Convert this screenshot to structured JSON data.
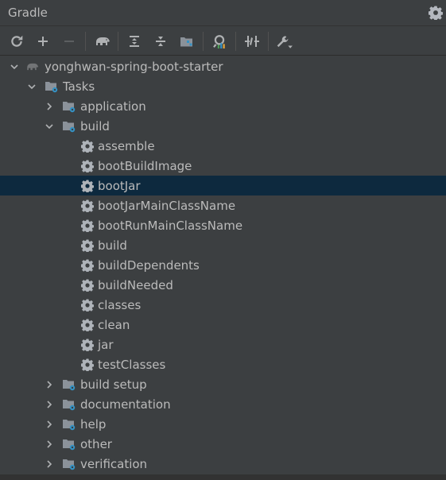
{
  "header": {
    "title": "Gradle"
  },
  "toolbar": {
    "buttons": [
      {
        "name": "reload-all-projects",
        "icon": "refresh-icon"
      },
      {
        "name": "link-project",
        "icon": "plus-icon"
      },
      {
        "name": "unlink-project",
        "icon": "minus-icon"
      },
      {
        "name": "execute-task",
        "icon": "elephant-icon"
      },
      {
        "name": "expand-all",
        "icon": "expand-all-icon"
      },
      {
        "name": "collapse-all",
        "icon": "collapse-all-icon"
      },
      {
        "name": "dependencies",
        "icon": "dependencies-icon"
      },
      {
        "name": "analyze",
        "icon": "analyze-icon"
      },
      {
        "name": "toggle-offline",
        "icon": "offline-icon"
      },
      {
        "name": "build-settings",
        "icon": "wrench-icon"
      }
    ]
  },
  "tree": {
    "project": "yonghwan-spring-boot-starter",
    "tasks_label": "Tasks",
    "groups": [
      "application",
      "build",
      "build setup",
      "documentation",
      "help",
      "other",
      "verification"
    ],
    "build_tasks": [
      "assemble",
      "bootBuildImage",
      "bootJar",
      "bootJarMainClassName",
      "bootRunMainClassName",
      "build",
      "buildDependents",
      "buildNeeded",
      "classes",
      "clean",
      "jar",
      "testClasses"
    ],
    "selected": "bootJar"
  },
  "colors": {
    "background": "#3c3f41",
    "text": "#bbbbbb",
    "selection": "#0d293e",
    "folder": "#8b929a",
    "gear": "#aeb3b9",
    "accent": "#3592c4"
  }
}
